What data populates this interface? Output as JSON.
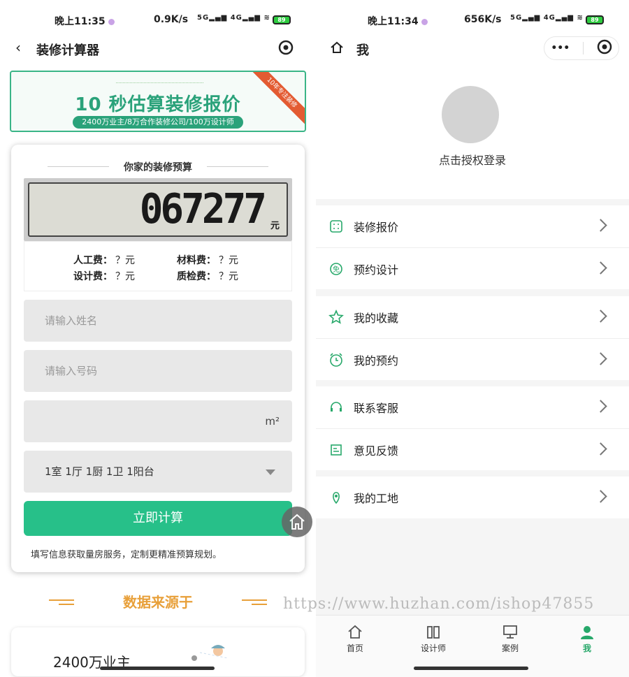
{
  "left": {
    "status": {
      "time": "晚上11:35",
      "net": "0.9K/s",
      "battery": "89"
    },
    "nav": {
      "title": "装修计算器"
    },
    "banner": {
      "headline": "10 秒估算装修报价",
      "sub": "2400万业主/8万合作装修公司/100万设计师",
      "corner": "10年专注装修"
    },
    "card": {
      "title": "你家的装修预算",
      "lcd_value": "067277",
      "lcd_unit": "元",
      "fees": [
        {
          "label": "人工费：",
          "value": "？元"
        },
        {
          "label": "材料费：",
          "value": "？元"
        },
        {
          "label": "设计费：",
          "value": "？元"
        },
        {
          "label": "质检费：",
          "value": "？元"
        }
      ],
      "name_placeholder": "请输入姓名",
      "phone_placeholder": "请输入号码",
      "area_unit": "m²",
      "layout_value": "1室 1厅 1厨 1卫 1阳台",
      "calc_button": "立即计算",
      "note": "填写信息获取量房服务，定制更精准预算规划。"
    },
    "source_title": "数据来源于",
    "stat_text": "2400万业主"
  },
  "right": {
    "status": {
      "time": "晚上11:34",
      "net": "656K/s",
      "battery": "89"
    },
    "nav": {
      "title": "我",
      "more": "•••"
    },
    "login_text": "点击授权登录",
    "groups": [
      [
        {
          "label": "装修报价",
          "icon": "calculator-icon"
        },
        {
          "label": "预约设计",
          "icon": "free-icon"
        }
      ],
      [
        {
          "label": "我的收藏",
          "icon": "star-icon"
        },
        {
          "label": "我的预约",
          "icon": "alarm-clock-icon"
        }
      ],
      [
        {
          "label": "联系客服",
          "icon": "headset-icon"
        },
        {
          "label": "意见反馈",
          "icon": "feedback-icon"
        }
      ],
      [
        {
          "label": "我的工地",
          "icon": "location-pin-icon"
        }
      ]
    ],
    "tabs": [
      {
        "label": "首页",
        "icon": "home-icon"
      },
      {
        "label": "设计师",
        "icon": "designer-icon"
      },
      {
        "label": "案例",
        "icon": "case-icon"
      },
      {
        "label": "我",
        "icon": "person-icon",
        "active": true
      }
    ],
    "accent": "#27a86a"
  },
  "watermark": "https://www.huzhan.com/ishop47855"
}
